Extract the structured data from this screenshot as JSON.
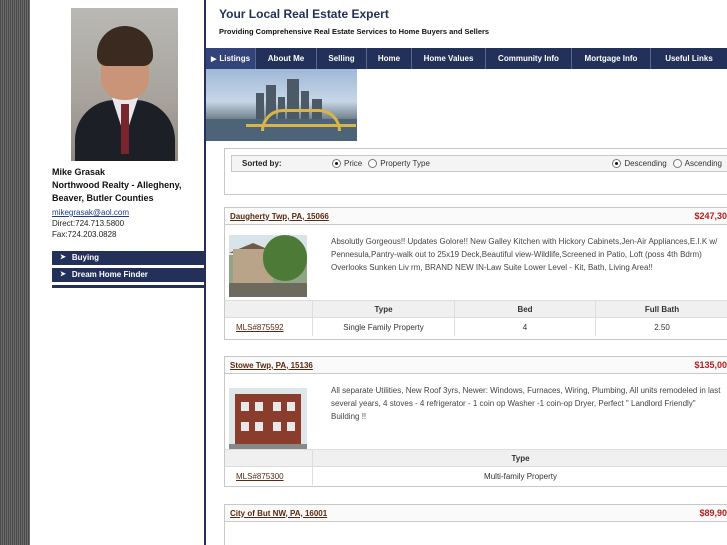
{
  "header": {
    "title": "Your Local Real Estate Expert",
    "subtitle": "Providing Comprehensive Real Estate Services to Home Buyers and Sellers"
  },
  "agent": {
    "name": "Mike Grasak",
    "company": "Northwood Realty - Allegheny, Beaver, Butler Counties",
    "email": "mikegrasak@aol.com",
    "direct": "Direct:724.713.5800",
    "fax": "Fax:724.203.0828"
  },
  "side_nav": [
    {
      "label": "Buying",
      "icon": "triangle-right-icon"
    },
    {
      "label": "Dream Home Finder",
      "icon": "triangle-right-icon"
    }
  ],
  "nav": {
    "tabs": [
      {
        "label": "Listings",
        "active": true
      },
      {
        "label": "About Me"
      },
      {
        "label": "Selling"
      },
      {
        "label": "Home"
      },
      {
        "label": "Home Values"
      },
      {
        "label": "Community Info"
      },
      {
        "label": "Mortgage Info"
      },
      {
        "label": "Useful Links"
      }
    ]
  },
  "sort": {
    "label": "Sorted by:",
    "options": [
      "Price",
      "Property Type"
    ],
    "selected": "Price",
    "order_options": [
      "Descending",
      "Ascending"
    ],
    "order_selected": "Descending"
  },
  "listings": [
    {
      "location": "Daugherty Twp, PA, 15066",
      "price": "$247,30",
      "description": "Absolutly Gorgeous!! Updates Golore!! New Galley Kitchen with Hickory Cabinets,Jen-Air Appliances,E.I.K w/ Pennesula,Pantry-walk out to 25x19 Deck,Beautiful view-Wildlife,Screened in Patio, Loft (poss 4th Bdrm) Overlooks Sunken Liv rm, BRAND NEW IN-Law Suite Lower Level - Kit, Bath, Living Area!!",
      "columns": [
        "Type",
        "Bed",
        "Full Bath"
      ],
      "mls": "MLS#875592",
      "values": [
        "Single Family Property",
        "4",
        "2.50"
      ]
    },
    {
      "location": "Stowe Twp, PA, 15136",
      "price": "$135,00",
      "description": "All separate Utilities, New Roof 3yrs, Newer: Windows, Furnaces, Wiring, Plumbing, All units remodeled in last several years, 4 stoves - 4 refrigerator - 1 coin op Washer -1 coin-op Dryer, Perfect \" Landlord Friendly\" Building !!",
      "columns": [
        "Type"
      ],
      "mls": "MLS#875300",
      "values": [
        "Multi-family Property"
      ]
    },
    {
      "location": "City of But NW, PA, 16001",
      "price": "$89,90"
    }
  ],
  "colors": {
    "navy": "#23305a",
    "price_red": "#b71c1c"
  }
}
